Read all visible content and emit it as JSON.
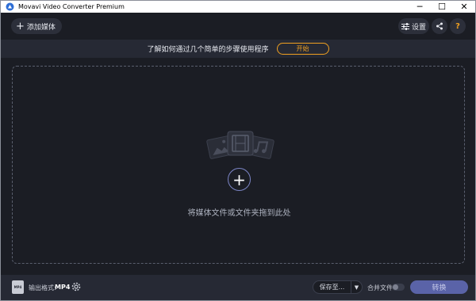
{
  "window": {
    "title": "Movavi Video Converter Premium",
    "controls": {
      "minimize": "─",
      "maximize": "☐",
      "close": "✕"
    }
  },
  "toolbar": {
    "add_media_label": "添加媒体",
    "settings_label": "设置",
    "share_icon": "share-icon",
    "help_label": "?"
  },
  "banner": {
    "text": "了解如何通过几个简单的步骤使用程序",
    "start_label": "开始"
  },
  "dropzone": {
    "add_symbol": "+",
    "hint": "将媒体文件或文件夹拖到此处"
  },
  "bottombar": {
    "format_label": "输出格式:",
    "format_value": "MP4",
    "format_icon_text": "MP4",
    "save_to_label": "保存至...",
    "merge_label": "合并文件:",
    "merge_enabled": false,
    "convert_label": "转换"
  },
  "colors": {
    "background": "#1b1d24",
    "panel": "#262934",
    "accent_orange": "#f0a020",
    "accent_convert": "#5a63a8"
  }
}
